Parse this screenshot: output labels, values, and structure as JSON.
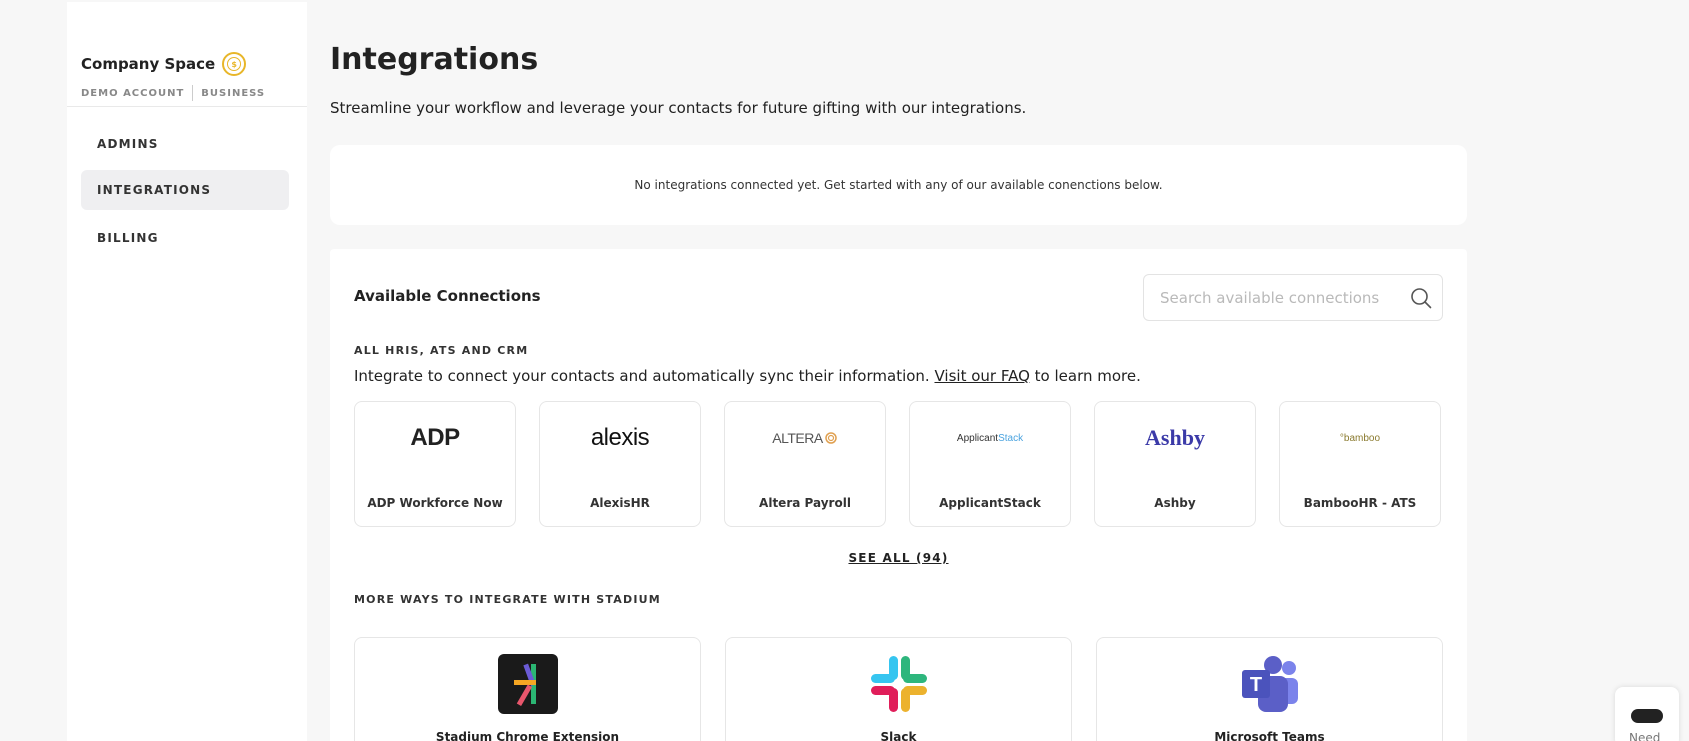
{
  "sidebar": {
    "brand_name": "Company Space",
    "coin_glyph": "$",
    "account_type": "DEMO ACCOUNT",
    "plan": "BUSINESS",
    "items": [
      {
        "label": "ADMINS",
        "active": false
      },
      {
        "label": "INTEGRATIONS",
        "active": true
      },
      {
        "label": "BILLING",
        "active": false
      }
    ]
  },
  "header": {
    "title": "Integrations",
    "subtitle": "Streamline your workflow and leverage your contacts for future gifting with our integrations."
  },
  "empty_state": {
    "message": "No integrations connected yet. Get started with any of our available conenctions below."
  },
  "connections": {
    "title": "Available Connections",
    "search_placeholder": "Search available connections",
    "section_hris": "ALL HRIS, ATS AND CRM",
    "desc_before": "Integrate to connect your contacts and automatically sync their information.",
    "desc_link": "Visit our FAQ",
    "desc_after": "to learn more.",
    "tiles": [
      {
        "logo": "ADP",
        "name": "ADP Workforce Now"
      },
      {
        "logo": "alexis",
        "name": "AlexisHR"
      },
      {
        "logo": "ALTERA",
        "name": "Altera Payroll"
      },
      {
        "logo_a": "Applicant",
        "logo_b": "Stack",
        "name": "ApplicantStack"
      },
      {
        "logo": "Ashby",
        "name": "Ashby"
      },
      {
        "logo": "°bamboo",
        "name": "BambooHR - ATS"
      }
    ],
    "see_all": "SEE ALL (94)",
    "section_more": "MORE WAYS TO INTEGRATE WITH STADIUM",
    "more": [
      {
        "name": "Stadium Chrome Extension",
        "icon": "stadium-icon"
      },
      {
        "name": "Slack",
        "icon": "slack-icon"
      },
      {
        "name": "Microsoft Teams",
        "icon": "teams-icon",
        "glyph": "T"
      }
    ]
  },
  "help_widget": {
    "label": "Need"
  },
  "colors": {
    "accent_gold": "#e8b629",
    "ashby_blue": "#3b3aa8",
    "teams_purple": "#5b5fc7"
  }
}
